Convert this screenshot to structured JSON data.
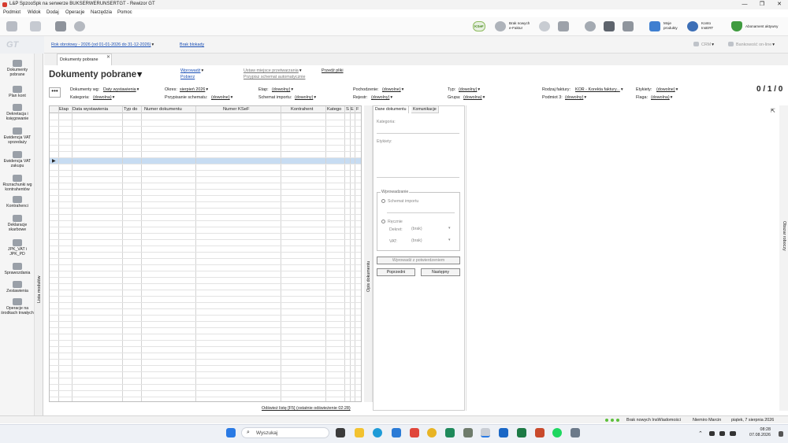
{
  "window": {
    "title": "L&P SpzooSpk na serwerze BUKSERWERUNSERTGT - Rewizor GT",
    "controls": [
      "—",
      "❐",
      "✕"
    ]
  },
  "menu": [
    "Podmiot",
    "Widok",
    "Dodaj",
    "Operacje",
    "Narzędzia",
    "Pomoc"
  ],
  "toolbar": {
    "ksef_badge": "KSeF",
    "brak_nowych_line1": "Brak nowych",
    "brak_nowych_line2": "e-Faktur",
    "moje_produkty_line1": "Moje",
    "moje_produkty_line2": "produkty",
    "konto_line1": "Konto",
    "konto_line2": "InsERT",
    "abonament": "Abonament aktywny"
  },
  "logo": "GT",
  "infobar": {
    "year": "Rok obrotowy - 2026 (od 01-01-2026 do 31-12-2026)",
    "blokady": "Brak blokady",
    "crm": "CRM",
    "bankowosc": "Bankowość on-line"
  },
  "sidebar": [
    {
      "icon": "documents-icon",
      "label": "Dokumenty pobrane"
    },
    {
      "icon": "chart-of-accounts-icon",
      "label": "Plan kont"
    },
    {
      "icon": "booking-icon",
      "label": "Dekretacja i księgowanie"
    },
    {
      "icon": "vat-sales-icon",
      "label": "Ewidencja VAT sprzedaży"
    },
    {
      "icon": "vat-purchase-icon",
      "label": "Ewidencja VAT zakupu"
    },
    {
      "icon": "settlements-icon",
      "label": "Rozrachunki wg kontrahentów"
    },
    {
      "icon": "contractors-icon",
      "label": "Kontrahenci"
    },
    {
      "icon": "declarations-icon",
      "label": "Deklaracje skarbowe"
    },
    {
      "icon": "jpk-icon",
      "label": "JPK_VAT i JPK_PD"
    },
    {
      "icon": "reports-icon",
      "label": "Sprawozdania"
    },
    {
      "icon": "statements-icon",
      "label": "Zestawienia"
    },
    {
      "icon": "fixed-assets-icon",
      "label": "Operacje na środkach trwałych"
    }
  ],
  "modules_label": "Lista modułów",
  "tab": {
    "label": "Dokumenty pobrane",
    "close": "✕"
  },
  "page": {
    "title": "Dokumenty pobrane",
    "actions": {
      "wprowadz": "Wprowadź",
      "pobierz": "Pobierz",
      "ustaw": "Ustaw miejsce przetwarzania",
      "przypisz": "Przypisz schemat automatycznie",
      "przedz": "Przedź pliki"
    },
    "counter": "0 / 1 / 0",
    "ellipsis": "•••"
  },
  "filters": {
    "dokumenty_wg": {
      "label": "Dokumenty wg:",
      "value": "Daty wystawienia"
    },
    "kategoria": {
      "label": "Kategoria:",
      "value": "(dowolna)"
    },
    "okres": {
      "label": "Okres:",
      "value": "sierpień 2026"
    },
    "przypisanie": {
      "label": "Przypisanie schematu:",
      "value": "(dowolne)"
    },
    "etap": {
      "label": "Etap:",
      "value": "(dowolny)"
    },
    "schemat": {
      "label": "Schemat importu:",
      "value": "(dowolny)"
    },
    "pochodzenie": {
      "label": "Pochodzenie:",
      "value": "(dowolne)"
    },
    "rejestr": {
      "label": "Rejestr:",
      "value": "(dowolny)"
    },
    "typ": {
      "label": "Typ:",
      "value": "(dowolny)"
    },
    "grupa": {
      "label": "Grupa:",
      "value": "(dowolna)"
    },
    "rodzaj": {
      "label": "Rodzaj faktury:",
      "value": "KOR - Korekta faktury..."
    },
    "podmiot": {
      "label": "Podmiot 3:",
      "value": "(dowolny)"
    },
    "etykiety": {
      "label": "Etykiety:",
      "value": "(dowolne)"
    },
    "flaga": {
      "label": "Flaga:",
      "value": "(dowolna)"
    }
  },
  "grid": {
    "columns": [
      "Etap",
      "Data wystawienia",
      "Typ do",
      "Numer dokumentu",
      "Numer KSeF",
      "Kontrahent",
      "Katego",
      "S",
      "E",
      "F"
    ],
    "row_pointer": "▶"
  },
  "refresh": "Odśwież listę [F5] (ostatnie odświeżenie 02:28)",
  "detail": {
    "opis_label": "Opis dokumentu",
    "tabs": [
      "Dane dokumentu",
      "Komunikacje"
    ],
    "kategoria": "Kategoria:",
    "etykiety": "Etykiety:",
    "wprowadzanie": "Wprowadzanie",
    "schemat_importu": "Schemat importu",
    "recznie": "Ręcznie",
    "dekret": "Dekret:",
    "dekret_value": "(brak)",
    "vat": "VAT:",
    "vat_value": "(brak)",
    "btn_wprowadz": "Wprowadź z potwierdzeniem",
    "btn_poprzedni": "Poprzedni",
    "btn_nastepny": "Następny"
  },
  "obszar_roboczy": "Obszar roboczy",
  "statusbar": {
    "brak_nowych": "Brak nowych InsWiadomości",
    "user": "Niemiro Marcin",
    "date": "piątek, 7 sierpnia 2026"
  },
  "taskbar": {
    "search": "Wyszukaj",
    "time": "08:28",
    "date": "07.08.2026"
  }
}
